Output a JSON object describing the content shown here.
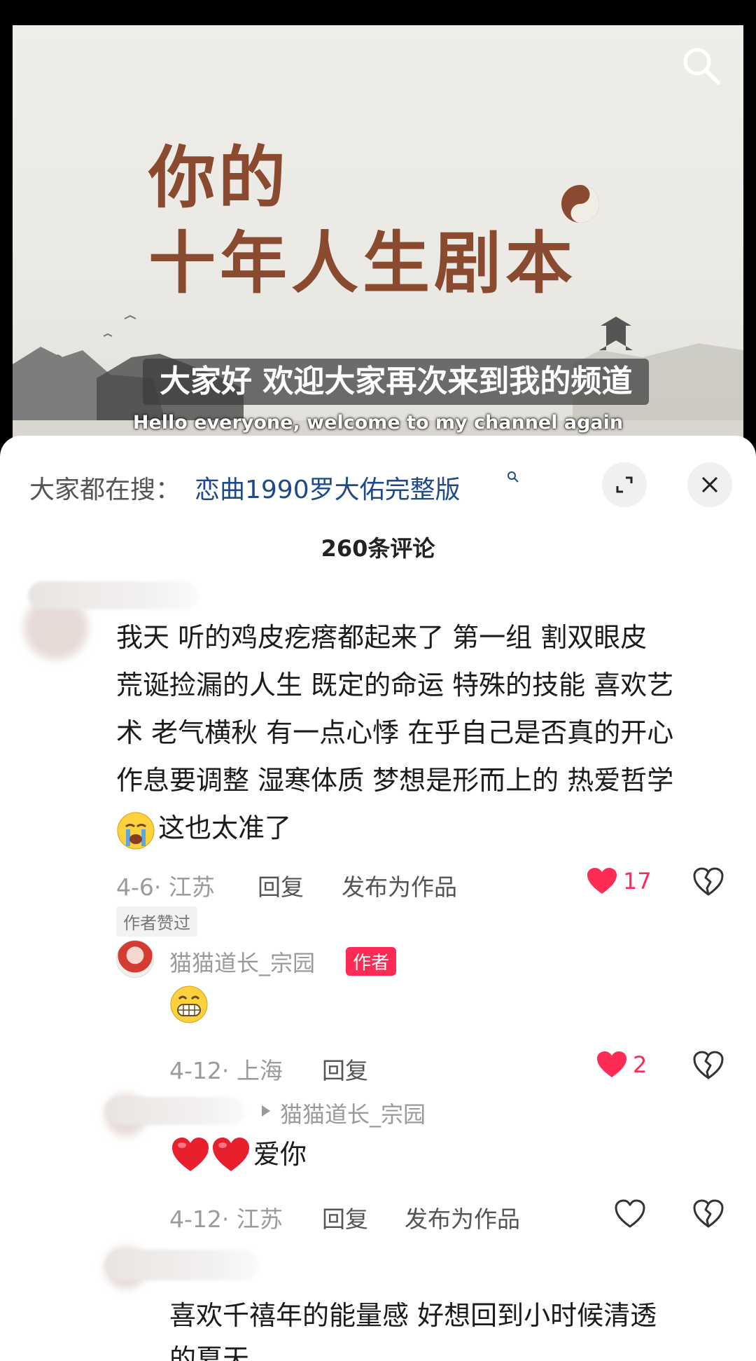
{
  "video": {
    "title_line1": "你的",
    "title_line2": "十年人生剧本",
    "subtitle_cn": "大家好 欢迎大家再次来到我的频道",
    "subtitle_en": "Hello everyone, welcome to my channel again"
  },
  "topbar": {
    "hot_search_prefix": "大家都在搜：",
    "hot_search_query": "恋曲1990罗大佑完整版"
  },
  "comment_count_label": "260条评论",
  "comments": [
    {
      "lines": [
        "我天 听的鸡皮疙瘩都起来了 第一组 割双眼皮",
        "荒诞捡漏的人生 既定的命运 特殊的技能 喜欢艺",
        "术 老气横秋 有一点心悸 在乎自己是否真的开心",
        "作息要调整 湿寒体质 梦想是形而上的 热爱哲学",
        "这也太准了"
      ],
      "emoji": "crying-face",
      "date_location": "4-6· 江苏",
      "reply_label": "回复",
      "publish_label": "发布为作品",
      "likes": "17",
      "liked": true,
      "author_liked_badge": "作者赞过"
    },
    {
      "username": "猫猫道长_宗园",
      "author_badge": "作者",
      "emoji": "grinning-face",
      "date_location": "4-12· 上海",
      "reply_label": "回复",
      "likes": "2",
      "liked": true
    },
    {
      "reply_to": "猫猫道长_宗园",
      "text": "爱你",
      "emoji": "red-heart",
      "date_location": "4-12· 江苏",
      "reply_label": "回复",
      "publish_label": "发布为作品",
      "liked": false
    },
    {
      "lines": [
        "喜欢千禧年的能量感 好想回到小时候清透",
        "的夏天"
      ]
    }
  ],
  "colors": {
    "like_red": "#fe2c55",
    "link_blue": "#1f4a8a",
    "title_brown": "#8a4a2f"
  }
}
